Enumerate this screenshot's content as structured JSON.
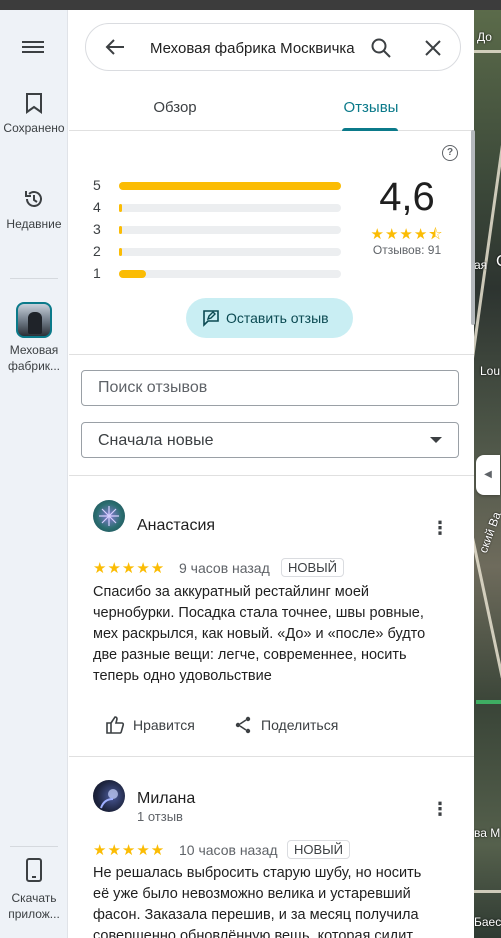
{
  "rail": {
    "saved_label": "Сохранено",
    "recent_label": "Недавние",
    "place_label": "Меховая фабрик...",
    "download_label": "Скачать прилож..."
  },
  "search": {
    "query": "Меховая фабрика Москвичка"
  },
  "tabs": [
    {
      "label": "Обзор",
      "active": false
    },
    {
      "label": "Отзывы",
      "active": true
    }
  ],
  "summary": {
    "score": "4,6",
    "stars": 4.6,
    "count_label": "Отзывов: 91",
    "distribution": [
      {
        "star": "5",
        "fraction": 1.0
      },
      {
        "star": "4",
        "fraction": 0.01
      },
      {
        "star": "3",
        "fraction": 0.01
      },
      {
        "star": "2",
        "fraction": 0.01
      },
      {
        "star": "1",
        "fraction": 0.12
      }
    ],
    "write_review_label": "Оставить отзыв"
  },
  "filters": {
    "search_placeholder": "Поиск отзывов",
    "sort_value": "Сначала новые"
  },
  "reviews": [
    {
      "author": "Анастасия",
      "meta": "",
      "rating": 5,
      "time": "9 часов назад",
      "badge": "НОВЫЙ",
      "text": "Спасибо за аккуратный рестайлинг моей чернобурки. Посадка стала точнее, швы ровные, мех раскрылся, как новый. «До» и «после» будто две разные вещи: легче, современнее, носить теперь одно удовольствие",
      "like_label": "Нравится",
      "share_label": "Поделиться"
    },
    {
      "author": "Милана",
      "meta": "1 отзыв",
      "rating": 5,
      "time": "10 часов назад",
      "badge": "НОВЫЙ",
      "text": "Не решалась выбросить старую шубу, но носить её уже было невозможно велика и устаревший фасон. Заказала перешив, и за месяц получила совершенно обновлённую вещь, которая сидит как"
    }
  ],
  "map_labels": [
    "До",
    "ая",
    "С",
    "Lou",
    "ский Ва",
    "ва М",
    "Баесо"
  ],
  "colors": {
    "accent": "#0b7a8a",
    "star": "#fbbc04",
    "chip": "#c9eef3"
  }
}
